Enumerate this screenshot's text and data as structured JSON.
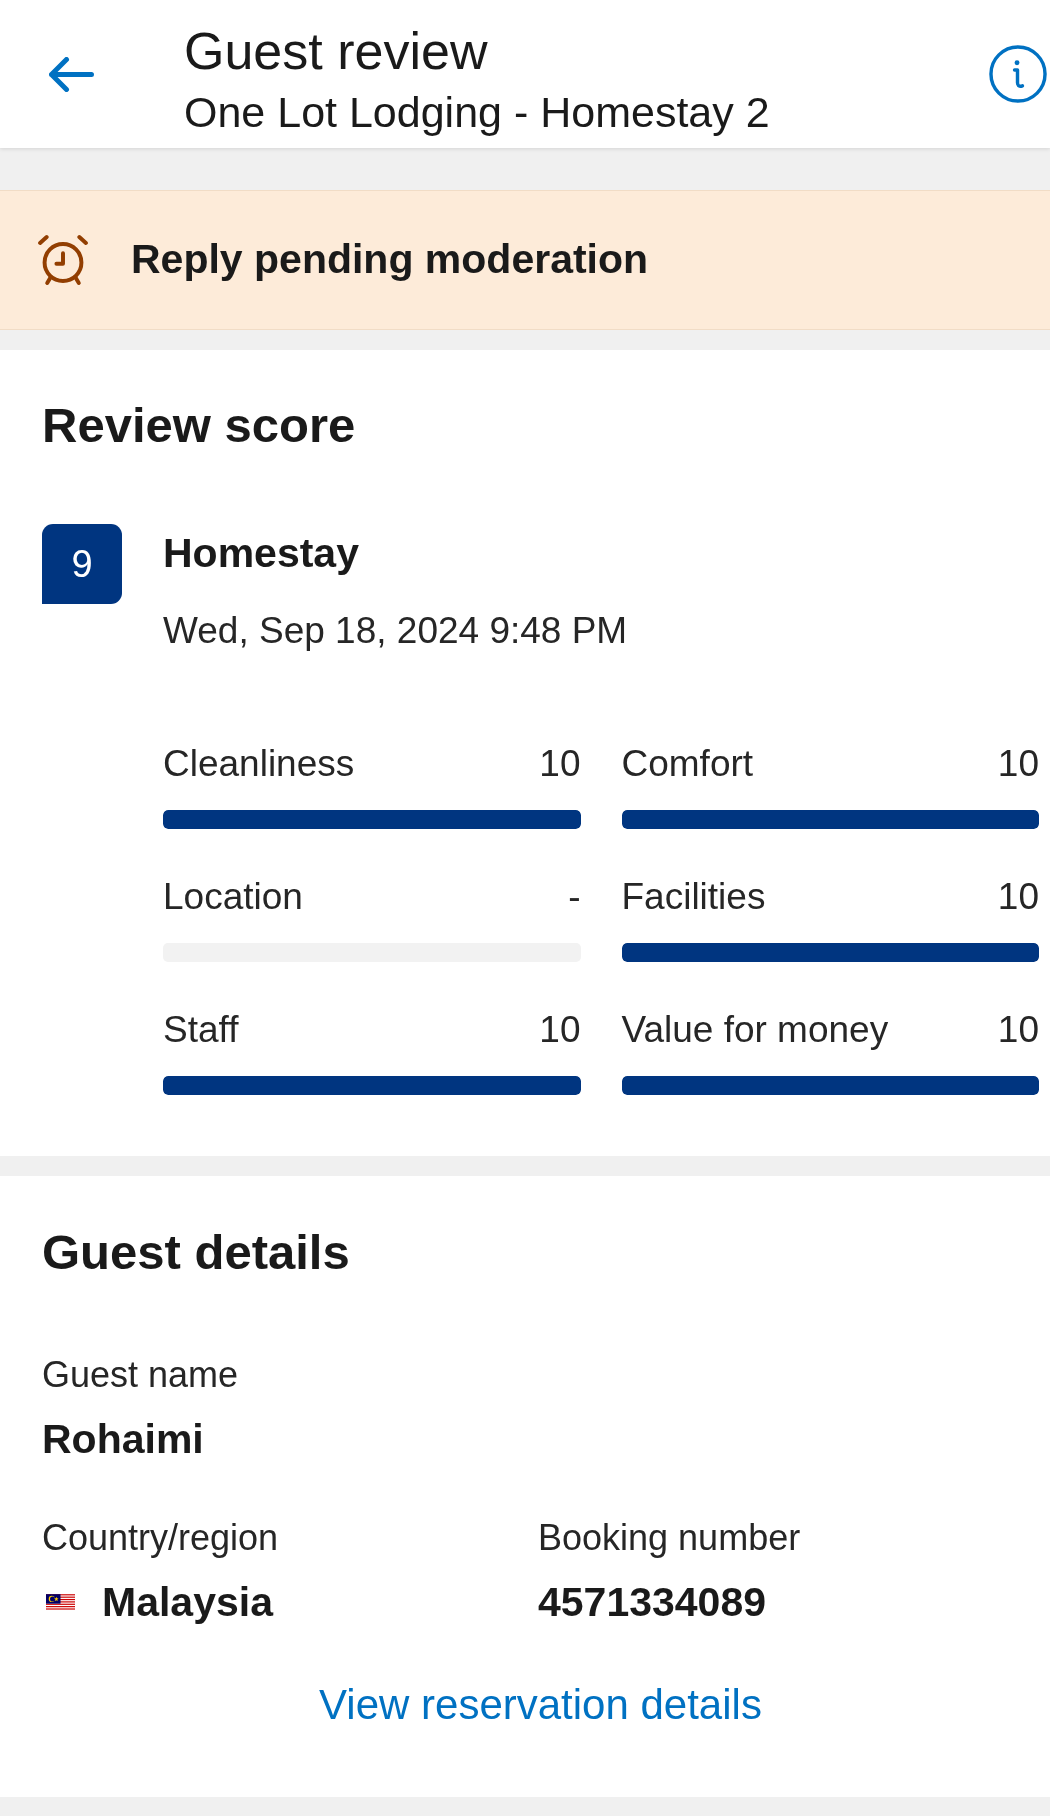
{
  "header": {
    "title": "Guest review",
    "subtitle": "One Lot Lodging - Homestay 2"
  },
  "notice": {
    "text": "Reply pending moderation"
  },
  "review_score": {
    "heading": "Review score",
    "score": "9",
    "property_type": "Homestay",
    "date": "Wed, Sep 18, 2024 9:48 PM",
    "categories": [
      {
        "name": "Cleanliness",
        "score": "10",
        "level": 1
      },
      {
        "name": "Comfort",
        "score": "10",
        "level": 1
      },
      {
        "name": "Location",
        "score": "-"
      },
      {
        "name": "Facilities",
        "score": "10",
        "level": 1
      },
      {
        "name": "Staff",
        "score": "10",
        "level": 1
      },
      {
        "name": "Value for money",
        "score": "10",
        "level": 1
      }
    ]
  },
  "guest_details": {
    "heading": "Guest details",
    "rows": [
      [
        {
          "kind": "text",
          "label": "Guest name",
          "value": "Rohaimi"
        }
      ],
      [
        {
          "kind": "country",
          "label": "Country/region",
          "value": "Malaysia"
        },
        {
          "kind": "text",
          "label": "Booking number",
          "value": "4571334089"
        }
      ]
    ],
    "link": "View reservation details"
  }
}
